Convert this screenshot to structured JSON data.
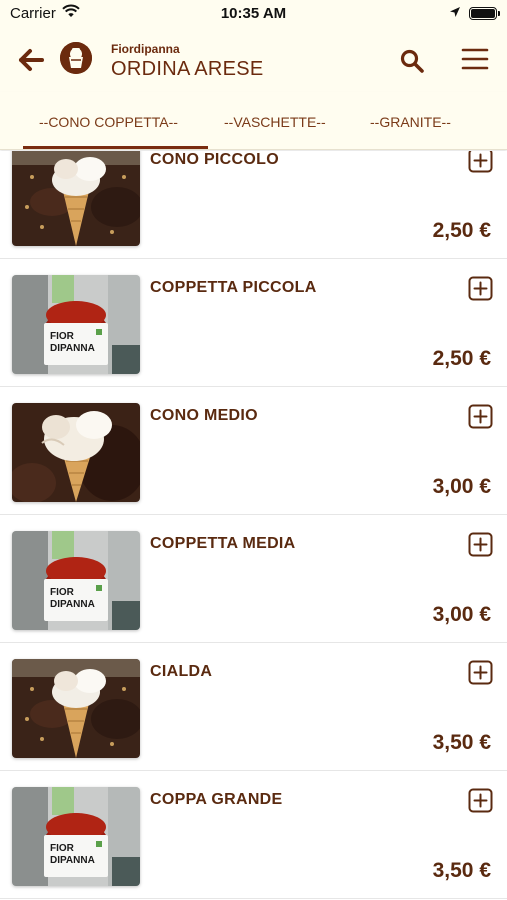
{
  "status_bar": {
    "carrier": "Carrier",
    "time": "10:35 AM"
  },
  "header": {
    "brand": "Fiordipanna",
    "store": "ORDINA ARESE",
    "icons": [
      "back-arrow-icon",
      "gelato-cup-logo",
      "search-icon",
      "menu-icon"
    ]
  },
  "tabs": [
    {
      "label": "--CONO COPPETTA--",
      "active": true
    },
    {
      "label": "--VASCHETTE--",
      "active": false
    },
    {
      "label": "--GRANITE--",
      "active": false
    }
  ],
  "products": [
    {
      "name": "CONO PICCOLO",
      "price": "2,50 €",
      "image": "cono"
    },
    {
      "name": "COPPETTA PICCOLA",
      "price": "2,50 €",
      "image": "coppetta"
    },
    {
      "name": "CONO MEDIO",
      "price": "3,00 €",
      "image": "cono-medio"
    },
    {
      "name": "COPPETTA MEDIA",
      "price": "3,00 €",
      "image": "coppetta"
    },
    {
      "name": "CIALDA",
      "price": "3,50 €",
      "image": "cono"
    },
    {
      "name": "COPPA GRANDE",
      "price": "3,50 €",
      "image": "coppetta"
    }
  ],
  "colors": {
    "brand": "#6b2a0e",
    "header_bg": "#fffdf0",
    "text": "#5a2a10"
  }
}
